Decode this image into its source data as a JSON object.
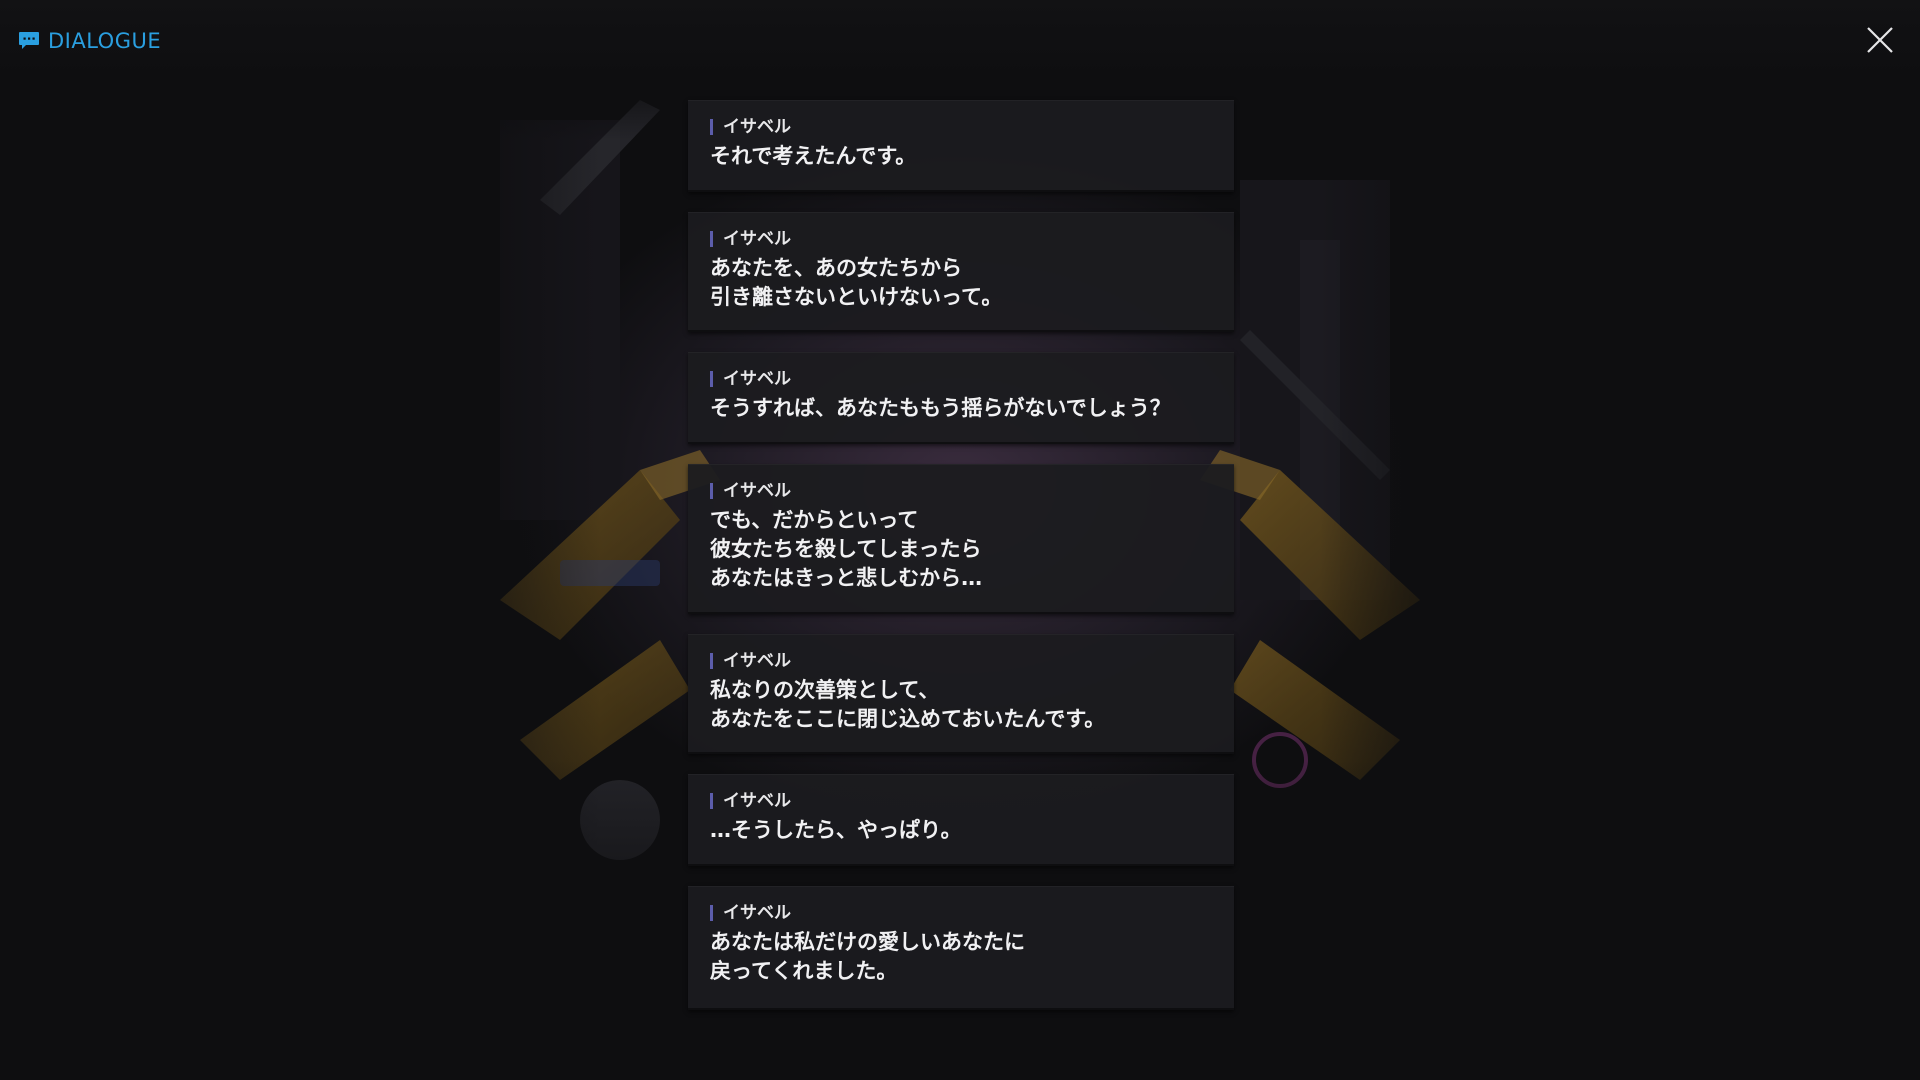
{
  "header": {
    "icon": "chat-bubble-icon",
    "title": "DIALOGUE",
    "accent_color": "#2a9fe0"
  },
  "close_button": {
    "icon": "close-icon"
  },
  "dialogue": {
    "speaker_bar_color": "#5c5dab",
    "entries": [
      {
        "speaker": "イサベル",
        "text": "それで考えたんです。"
      },
      {
        "speaker": "イサベル",
        "text": "あなたを、あの女たちから\n引き離さないといけないって。"
      },
      {
        "speaker": "イサベル",
        "text": "そうすれば、あなたももう揺らがないでしょう？"
      },
      {
        "speaker": "イサベル",
        "text": "でも、だからといって\n彼女たちを殺してしまったら\nあなたはきっと悲しむから…"
      },
      {
        "speaker": "イサベル",
        "text": "私なりの次善策として、\nあなたをここに閉じ込めておいたんです。"
      },
      {
        "speaker": "イサベル",
        "text": "…そうしたら、やっぱり。"
      },
      {
        "speaker": "イサベル",
        "text": "あなたは私だけの愛しいあなたに\n戻ってくれました。"
      }
    ]
  }
}
